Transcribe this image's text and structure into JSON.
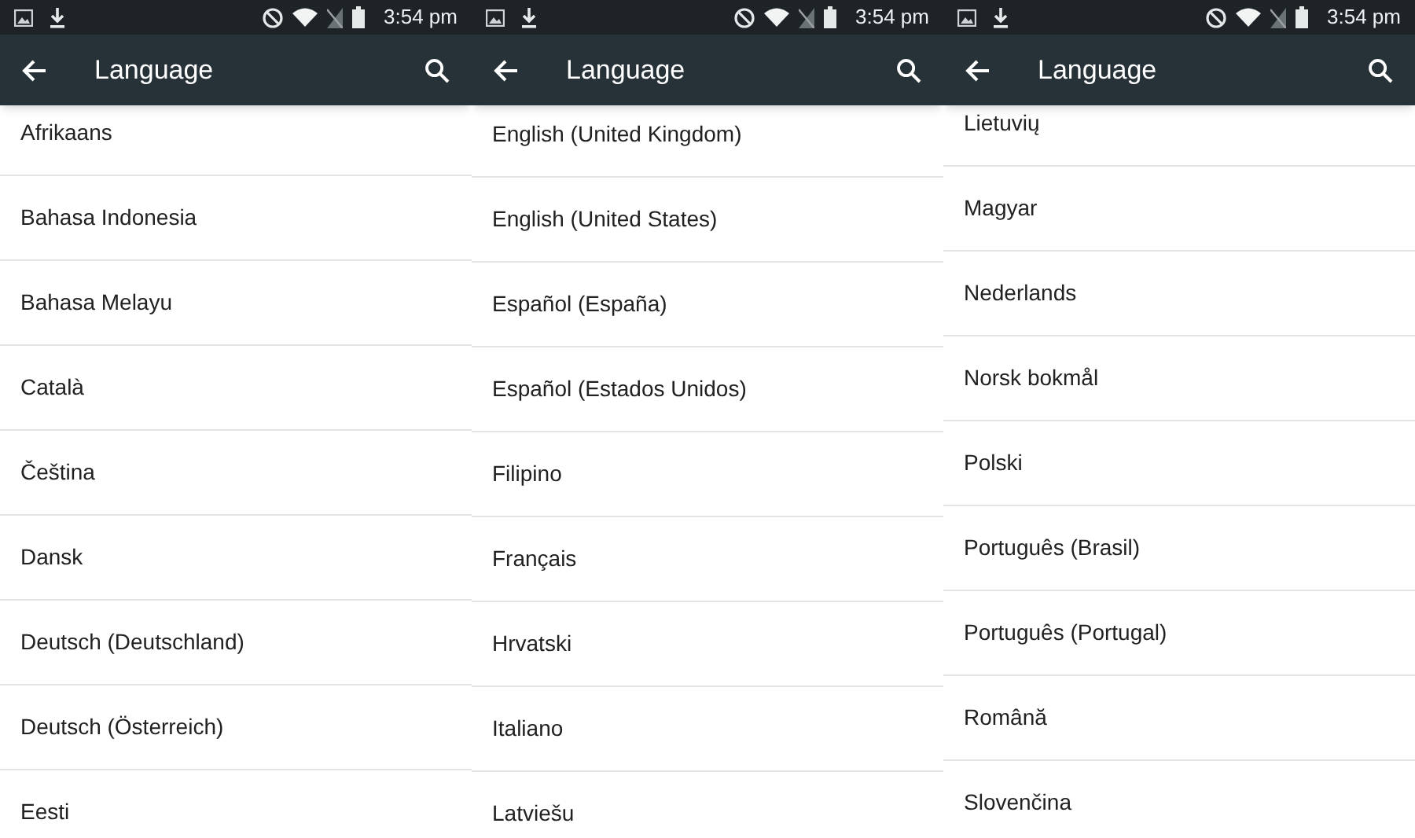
{
  "screens": [
    {
      "status_bar": {
        "time": "3:54 pm"
      },
      "toolbar": {
        "title": "Language"
      },
      "items": [
        "Afrikaans",
        "Bahasa Indonesia",
        "Bahasa Melayu",
        "Català",
        "Čeština",
        "Dansk",
        "Deutsch (Deutschland)",
        "Deutsch (Österreich)",
        "Eesti"
      ]
    },
    {
      "status_bar": {
        "time": "3:54 pm"
      },
      "toolbar": {
        "title": "Language"
      },
      "items": [
        "English (United Kingdom)",
        "English (United States)",
        "Español (España)",
        "Español (Estados Unidos)",
        "Filipino",
        "Français",
        "Hrvatski",
        "Italiano",
        "Latviešu"
      ]
    },
    {
      "status_bar": {
        "time": "3:54 pm"
      },
      "toolbar": {
        "title": "Language"
      },
      "items": [
        "Lietuvių",
        "Magyar",
        "Nederlands",
        "Norsk bokmål",
        "Polski",
        "Português (Brasil)",
        "Português (Portugal)",
        "Română",
        "Slovenčina"
      ]
    }
  ]
}
